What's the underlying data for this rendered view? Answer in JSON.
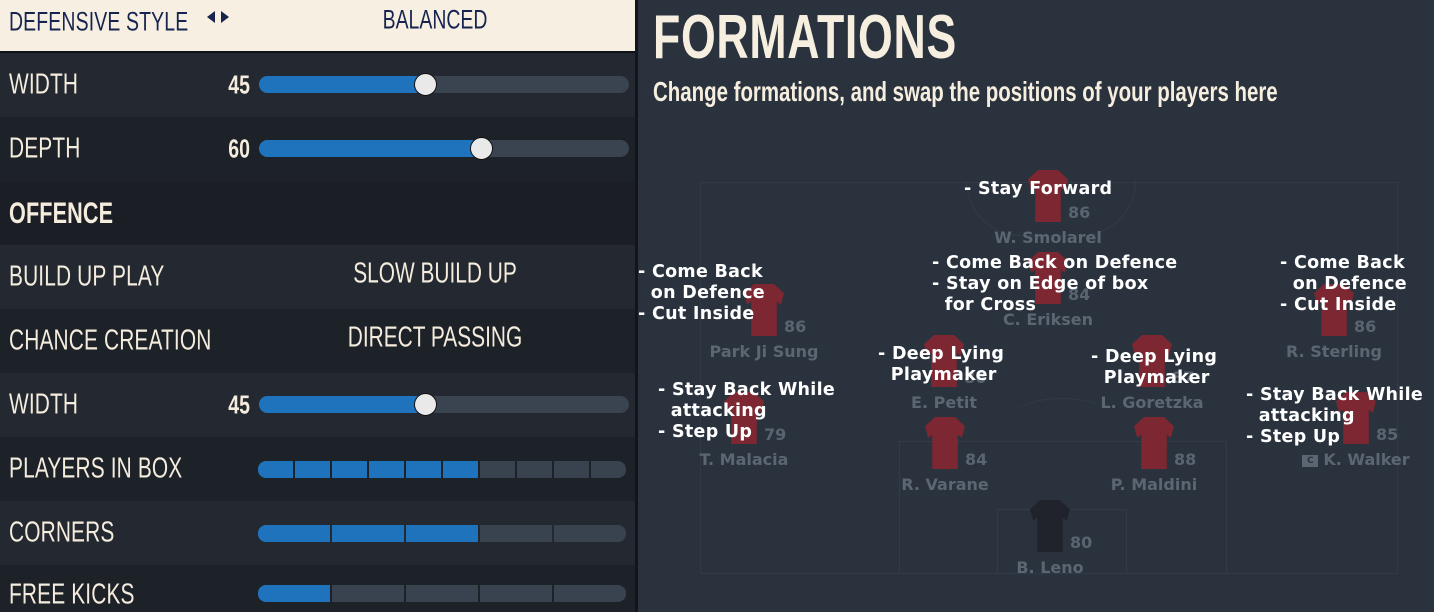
{
  "left_panel": {
    "defensive_style": {
      "label": "DEFENSIVE STYLE",
      "value": "BALANCED"
    },
    "defence_width": {
      "label": "WIDTH",
      "value": 45
    },
    "depth": {
      "label": "DEPTH",
      "value": 60
    },
    "offence_section": "OFFENCE",
    "build_up_play": {
      "label": "BUILD UP PLAY",
      "value": "SLOW BUILD UP"
    },
    "chance_creation": {
      "label": "CHANCE CREATION",
      "value": "DIRECT PASSING"
    },
    "offence_width": {
      "label": "WIDTH",
      "value": 45
    },
    "players_in_box": {
      "label": "PLAYERS IN BOX",
      "value": 6,
      "max": 10
    },
    "corners": {
      "label": "CORNERS",
      "value": 3,
      "max": 5
    },
    "free_kicks": {
      "label": "FREE KICKS",
      "value": 1,
      "max": 5
    },
    "slider_max": 100
  },
  "right_panel": {
    "title": "FORMATIONS",
    "subtitle": "Change formations, and swap the positions of your players here",
    "players": [
      {
        "id": "smolarel",
        "name": "W. Smolarel",
        "rating": "86"
      },
      {
        "id": "eriksen",
        "name": "C. Eriksen",
        "rating": "84"
      },
      {
        "id": "park",
        "name": "Park Ji Sung",
        "rating": "86"
      },
      {
        "id": "sterling",
        "name": "R. Sterling",
        "rating": "86"
      },
      {
        "id": "petit",
        "name": "E. Petit",
        "rating": "86"
      },
      {
        "id": "goretzka",
        "name": "L. Goretzka",
        "rating": "87"
      },
      {
        "id": "malacia",
        "name": "T. Malacia",
        "rating": "79"
      },
      {
        "id": "walker",
        "name": "K. Walker",
        "rating": "85",
        "captain": "C"
      },
      {
        "id": "varane",
        "name": "R. Varane",
        "rating": "84"
      },
      {
        "id": "maldini",
        "name": "P. Maldini",
        "rating": "88"
      },
      {
        "id": "leno",
        "name": "B. Leno",
        "rating": "80"
      }
    ],
    "instructions": {
      "smolarel": "- Stay Forward",
      "eriksen": "- Come Back on Defence\n- Stay on Edge of box\n  for Cross",
      "park": "- Come Back\n  on Defence\n- Cut Inside",
      "sterling": "- Come Back\n  on Defence\n- Cut Inside",
      "petit": "- Deep Lying\n  Playmaker",
      "goretzka": "- Deep Lying\n  Playmaker",
      "malacia": "- Stay Back While\n  attacking\n- Step Up",
      "walker": "- Stay Back While\n  attacking\n- Step Up"
    }
  },
  "colors": {
    "accent_blue": "#1f73bd",
    "header_cream": "#f6efe2",
    "header_navy": "#17244f",
    "shirt_red": "#8b2630"
  }
}
